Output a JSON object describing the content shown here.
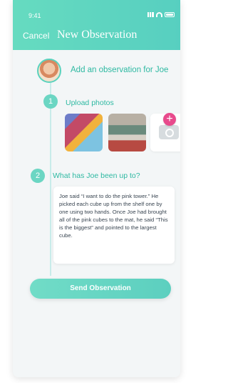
{
  "status_bar": {
    "time": "9:41"
  },
  "header": {
    "cancel": "Cancel",
    "title": "New Observation"
  },
  "main": {
    "prompt": "Add an observation for Joe",
    "step1": {
      "number": "1",
      "label": "Upload photos"
    },
    "step2": {
      "number": "2",
      "label": "What has Joe been up to?"
    },
    "note": "Joe said “I want to do the pink tower.” He picked each cube up from the shelf one by one using two hands. Once Joe had brought all of the pink cubes to the mat, he said “This is the biggest” and pointed to the largest cube.",
    "send_button": "Send Observation"
  },
  "colors": {
    "accent": "#5ad2bd",
    "header_gradient_left": "#66dbc0",
    "header_gradient_right": "#57cfc0",
    "plus": "#e84a8c"
  },
  "icons": {
    "status": [
      "signal-icon",
      "wifi-icon",
      "battery-icon"
    ],
    "camera": "camera-icon",
    "plus": "plus-icon"
  }
}
